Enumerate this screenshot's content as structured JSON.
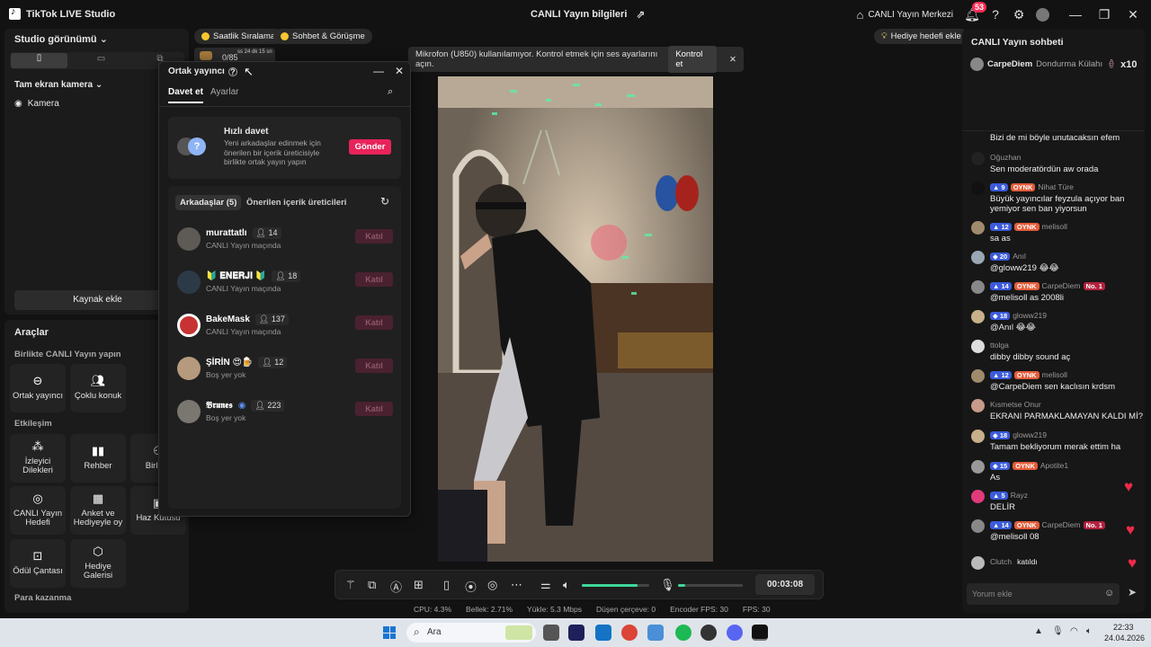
{
  "app": {
    "title": "TikTok LIVE Studio",
    "center_title": "CANLI Yayın bilgileri",
    "live_center": "CANLI Yayın Merkezi",
    "notif_count": "53"
  },
  "left": {
    "studio_view": "Studio görünümü",
    "fullscreen_cam": "Tam ekran kamera",
    "camera": "Kamera",
    "add_source": "Kaynak ekle",
    "tools_title": "Araçlar",
    "sec_live_together": "Birlikte CANLI Yayın yapın",
    "sec_interaction": "Etkileşim",
    "sec_earn": "Para kazanma",
    "tools": {
      "cohost": "Ortak yayıncı",
      "multi_guest": "Çoklu konuk",
      "viewer_requests": "İzleyici Dilekleri",
      "guide": "Rehber",
      "together_partial": "Birlikte",
      "live_goal": "CANLI Yayın Hedefi",
      "poll": "Anket ve Hediyeyle oy",
      "treasure_partial": "Haz Kutusu",
      "reward_bag": "Ödül Çantası",
      "gift_gallery": "Hediye Galerisi"
    }
  },
  "pills": {
    "hourly": "Saatlik Sıralama",
    "chat_meet": "Sohbet & Görüşme",
    "gift_goal": "Hediye hedefi ekle",
    "timer_small": "ss 24 dk 15 sn",
    "progress": "0/85"
  },
  "toast": {
    "text": "Mikrofon (U850) kullanılamıyor. Kontrol etmek için ses ayarlarını açın.",
    "action": "Kontrol et"
  },
  "cohost": {
    "title": "Ortak yayıncı",
    "tab_invite": "Davet et",
    "tab_settings": "Ayarlar",
    "quick_title": "Hızlı davet",
    "quick_desc": "Yeni arkadaşlar edinmek için önerilen bir içerik üreticisiyle birlikte ortak yayın yapın",
    "send": "Gönder",
    "tab_friends": "Arkadaşlar (5)",
    "tab_suggested": "Önerilen içerik üreticileri",
    "join_label": "Katıl",
    "friends": [
      {
        "name": "murattatlı",
        "count": "14",
        "sub": "CANLI Yayın maçında"
      },
      {
        "name": "🔰 𝐄𝐍𝐄𝐑𝐉𝐈 🔰",
        "count": "18",
        "sub": "CANLI Yayın maçında"
      },
      {
        "name": "BakeMask",
        "count": "137",
        "sub": "CANLI Yayın maçında"
      },
      {
        "name": "ŞİRİN 😍🍺",
        "count": "12",
        "sub": "Boş yer yok"
      },
      {
        "name": "𝕭𝖗𝖚𝖓𝖊𝖘",
        "count": "223",
        "sub": "Boş yer yok"
      }
    ]
  },
  "controls": {
    "timer": "00:03:08"
  },
  "status": {
    "cpu": "CPU: 4.3%",
    "mem": "Bellek: 2.71%",
    "upload": "Yükle: 5.3 Mbps",
    "dropped": "Düşen çerçeve: 0",
    "encoder": "Encoder FPS: 30",
    "fps": "FPS: 30"
  },
  "chat": {
    "title": "CANLI Yayın sohbeti",
    "pinned": {
      "user": "CarpeDiem",
      "gift": "Dondurma Külahı",
      "mult": "x10"
    },
    "messages": [
      {
        "user": "",
        "text": "Bizi de mi böyle unutacaksın efem"
      },
      {
        "user": "Oğuzhan",
        "text": "Sen moderatördün aw orada"
      },
      {
        "user": "Nihat Türe",
        "lvl": "9",
        "text": "Büyük yayıncılar feyzula açıyor ban yemiyor sen ban yiyorsun"
      },
      {
        "user": "melisoll",
        "lvl": "12",
        "text": "sa as"
      },
      {
        "user": "Anıl",
        "lvl": "20",
        "text": "@gloww219 😂😂"
      },
      {
        "user": "CarpeDiem",
        "lvl": "14",
        "text": "@melisoll as 2008li"
      },
      {
        "user": "gloww219",
        "lvl": "18",
        "text": "@Anıl 😂😂"
      },
      {
        "user": "ttolga",
        "text": "dibby dibby sound aç"
      },
      {
        "user": "melisoll",
        "lvl": "12",
        "text": "@CarpeDiem sen kaclısın krdsm"
      },
      {
        "user": "Kısmetse Onur",
        "text": "EKRANI PARMAKLAMAYAN KALDI Mİ?"
      },
      {
        "user": "gloww219",
        "lvl": "18",
        "text": "Tamam bekliyorum merak ettim ha"
      },
      {
        "user": "Apotite1",
        "lvl": "15",
        "text": "As"
      },
      {
        "user": "Rayz",
        "lvl": "5",
        "text": "DELİR"
      },
      {
        "user": "CarpeDiem",
        "lvl": "14",
        "text": "@melisoll 08"
      },
      {
        "user": "Clutch",
        "text": "katıldı"
      }
    ],
    "oynk": "OYNK",
    "no1": "No. 1",
    "input_placeholder": "Yorum ekle"
  },
  "taskbar": {
    "search": "Ara",
    "time": "22:33",
    "date": "24.04.2026"
  }
}
